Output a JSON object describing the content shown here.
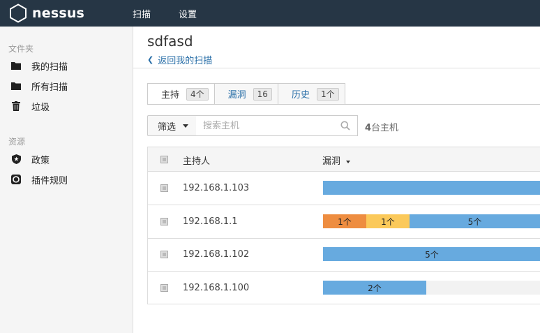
{
  "app": {
    "brand": "nessus"
  },
  "nav": {
    "scan": "扫描",
    "settings": "设置"
  },
  "sidebar": {
    "folders_heading": "文件夹",
    "folders": [
      {
        "label": "我的扫描",
        "icon": "folder-icon"
      },
      {
        "label": "所有扫描",
        "icon": "folder-icon"
      },
      {
        "label": "垃圾",
        "icon": "trash-icon"
      }
    ],
    "resources_heading": "资源",
    "resources": [
      {
        "label": "政策",
        "icon": "policy-shield-icon"
      },
      {
        "label": "插件规则",
        "icon": "plugin-rules-icon"
      }
    ]
  },
  "page": {
    "title": "sdfasd",
    "back_link": "返回我的扫描"
  },
  "tabs": [
    {
      "label": "主持",
      "count": "4个",
      "active": true
    },
    {
      "label": "漏洞",
      "count": "16",
      "active": false
    },
    {
      "label": "历史",
      "count": "1个",
      "active": false
    }
  ],
  "filter": {
    "label": "筛选",
    "search_placeholder": "搜索主机",
    "count_num": "4",
    "count_text": "台主机"
  },
  "table": {
    "columns": {
      "host": "主持人",
      "vulns": "漏洞"
    },
    "rows": [
      {
        "ip": "192.168.1.103",
        "segments": [
          {
            "label": "",
            "frac": 1.0,
            "color": "#67aadf"
          }
        ]
      },
      {
        "ip": "192.168.1.1",
        "segments": [
          {
            "label": "1个",
            "frac": 0.2,
            "color": "#ee8d40"
          },
          {
            "label": "1个",
            "frac": 0.2,
            "color": "#fbc95a"
          },
          {
            "label": "5个",
            "frac": 0.6,
            "color": "#67aadf"
          }
        ]
      },
      {
        "ip": "192.168.1.102",
        "segments": [
          {
            "label": "5个",
            "frac": 1.0,
            "color": "#67aadf"
          }
        ]
      },
      {
        "ip": "192.168.1.100",
        "segments": [
          {
            "label": "2个",
            "frac": 0.474,
            "color": "#67aadf"
          }
        ]
      }
    ]
  }
}
